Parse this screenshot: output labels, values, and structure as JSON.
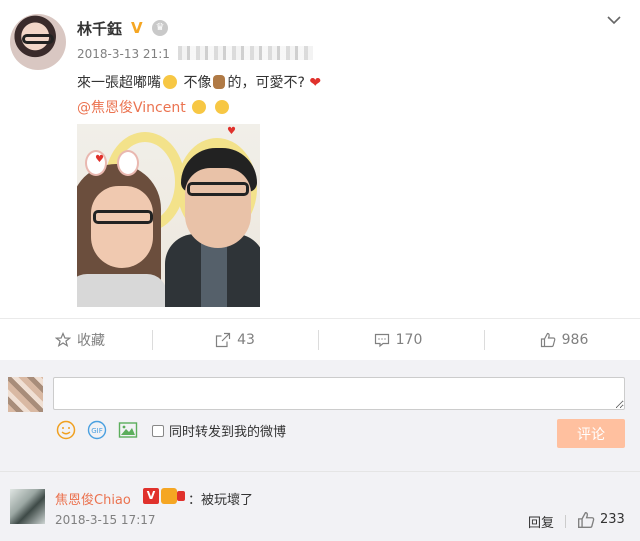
{
  "post": {
    "username": "林千鈺",
    "verified_mark": "V",
    "timestamp": "2018-3-13 21:1",
    "text": "來一張超嘟嘴",
    "text_middle": "不像",
    "text_end": "的，可愛不?",
    "mention": "@焦恩俊Vincent"
  },
  "actions": {
    "favorite_label": "收藏",
    "repost_count": "43",
    "comment_count": "170",
    "like_count": "986"
  },
  "comment_box": {
    "placeholder": "",
    "forward_label": "同时转发到我的微博",
    "submit_label": "评论"
  },
  "comment": {
    "username": "焦恩俊Chiao",
    "verified_mark": "V",
    "text": "：被玩壞了",
    "timestamp": "2018-3-15 17:17",
    "reply_label": "回复",
    "like_count": "233"
  },
  "colors": {
    "accent": "#eb7350",
    "heart": "#e0312c",
    "verified": "#f5a623",
    "submit_disabled": "#ffc09f"
  }
}
